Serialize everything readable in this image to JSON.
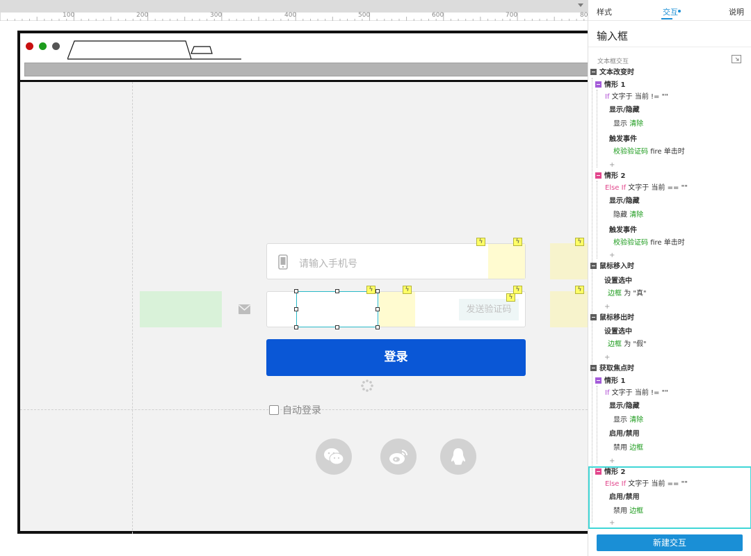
{
  "ruler": {
    "labels": [
      "100",
      "200",
      "300",
      "400",
      "500",
      "600",
      "700",
      "80"
    ]
  },
  "mockup": {
    "phone_placeholder": "请输入手机号",
    "send_code_label": "发送验证码",
    "login_label": "登录",
    "auto_login_label": "自动登录",
    "accent_color": "#0a57d6",
    "icons": [
      "phone-icon",
      "mail-icon",
      "spinner-icon",
      "wechat-icon",
      "weibo-icon",
      "qq-icon",
      "bolt-icon"
    ]
  },
  "panel": {
    "tabs": {
      "style": "样式",
      "interact": "交互",
      "notes": "说明"
    },
    "title": "输入框",
    "section_label": "文本框交互",
    "events": {
      "text_change": "文本改变时",
      "mouse_enter": "鼠标移入时",
      "mouse_leave": "鼠标移出时",
      "focus": "获取焦点时"
    },
    "cases": {
      "case1": "情形 1",
      "case2": "情形 2"
    },
    "conditions": {
      "if_kw": "If",
      "elseif_kw": "Else If",
      "neq": "文字于 当前 != \"\"",
      "eq": "文字于 当前 == \"\""
    },
    "actions": {
      "show_hide": "显示/隐藏",
      "fire_event": "触发事件",
      "set_selected": "设置选中",
      "enable_disable": "启用/禁用"
    },
    "details": {
      "show": "显示",
      "hide": "隐藏",
      "disable": "禁用",
      "clear_target": "清除",
      "verify_target": "校验验证码",
      "fire_suffix": "fire 单击时",
      "border_target": "边框",
      "true_suffix": "为 \"真\"",
      "false_suffix": "为 \"假\""
    },
    "plus": "+",
    "new_button_label": "新建交互",
    "accent_color": "#1a8fd6"
  }
}
